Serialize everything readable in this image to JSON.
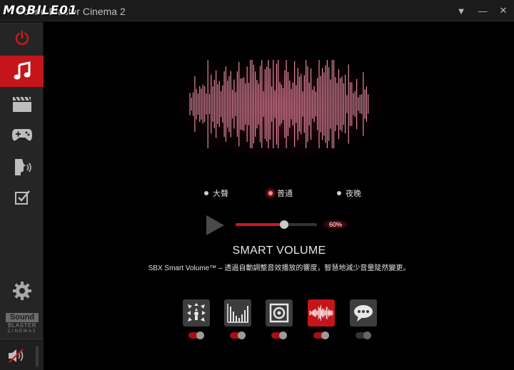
{
  "titlebar": {
    "watermark": "MOBILE01",
    "app_title": "Sound Blaster Cinema 2",
    "minimize_symbol": "—",
    "dropdown_symbol": "▼",
    "close_symbol": "✕"
  },
  "sidebar": {
    "items": [
      {
        "name": "power",
        "icon": "power-icon"
      },
      {
        "name": "music",
        "icon": "music-note-icon",
        "active": true
      },
      {
        "name": "movie",
        "icon": "clapperboard-icon"
      },
      {
        "name": "game",
        "icon": "gamepad-icon"
      },
      {
        "name": "voice",
        "icon": "voice-icon"
      },
      {
        "name": "checklist",
        "icon": "checkbox-icon"
      },
      {
        "name": "settings",
        "icon": "gear-icon"
      }
    ],
    "brand": {
      "line1": "Sound",
      "line2": "BLASTER",
      "line3": "CINEMA2"
    },
    "mute_icon": "speaker-muted-icon"
  },
  "main": {
    "modes": [
      {
        "label": "大聲",
        "selected": false
      },
      {
        "label": "普通",
        "selected": true
      },
      {
        "label": "夜晚",
        "selected": false
      }
    ],
    "level": {
      "value": 0.6,
      "label": "60%"
    },
    "feature_title": "SMART VOLUME",
    "feature_desc": "SBX Smart Volume™ – 透過自動調整音效播放的響度，智慧地減少音量陡然變更。",
    "effects": [
      {
        "name": "surround",
        "icon": "surround-icon",
        "on": true
      },
      {
        "name": "crystalizer",
        "icon": "equalizer-bars-icon",
        "on": true
      },
      {
        "name": "bass",
        "icon": "speaker-icon",
        "on": true
      },
      {
        "name": "smart-volume",
        "icon": "waveform-icon",
        "on": true,
        "active": true
      },
      {
        "name": "dialog-plus",
        "icon": "speech-bubble-icon",
        "on": false
      }
    ]
  },
  "colors": {
    "accent": "#c4151b",
    "sidebar": "#252525",
    "waveform": "#e08aa0"
  }
}
